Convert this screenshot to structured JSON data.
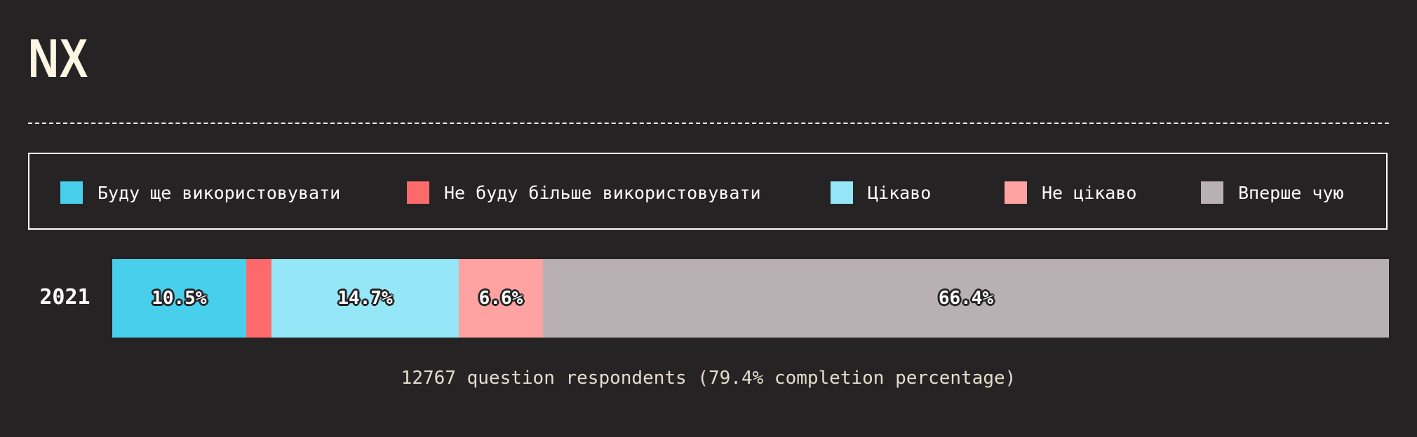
{
  "title": "NX",
  "legend": [
    {
      "label": "Буду ще використовувати",
      "color": "#48cfeb"
    },
    {
      "label": "Не буду більше використовувати",
      "color": "#fd6a6c"
    },
    {
      "label": "Цікаво",
      "color": "#95e6f7"
    },
    {
      "label": "Не цікаво",
      "color": "#fea2a2"
    },
    {
      "label": "Вперше чую",
      "color": "#b9b0b3"
    }
  ],
  "chart_data": {
    "type": "bar",
    "orientation": "horizontal",
    "stacked": "percent",
    "categories": [
      "2021"
    ],
    "series": [
      {
        "name": "Буду ще використовувати",
        "values": [
          10.5
        ],
        "label": "10.5%",
        "color": "#48cfeb"
      },
      {
        "name": "Не буду більше використовувати",
        "values": [
          2.0
        ],
        "label": "",
        "color": "#fd6a6c"
      },
      {
        "name": "Цікаво",
        "values": [
          14.7
        ],
        "label": "14.7%",
        "color": "#95e6f7"
      },
      {
        "name": "Не цікаво",
        "values": [
          6.6
        ],
        "label": "6.6%",
        "color": "#fea2a2"
      },
      {
        "name": "Вперше чую",
        "values": [
          66.4
        ],
        "label": "66.4%",
        "color": "#b9b0b3"
      }
    ],
    "legend_position": "top",
    "grid": false
  },
  "footnote": "12767 question respondents (79.4% completion percentage)"
}
